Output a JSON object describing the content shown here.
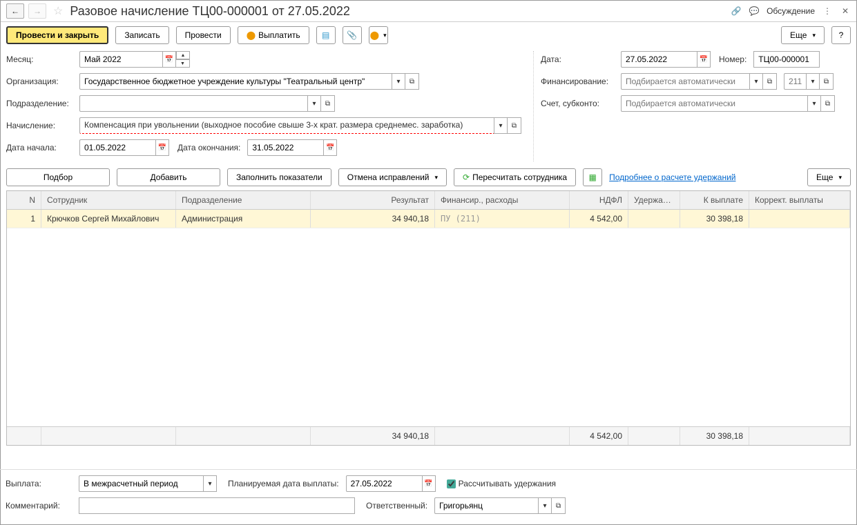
{
  "title": "Разовое начисление ТЦ00-000001 от 27.05.2022",
  "titlebar": {
    "discuss": "Обсуждение"
  },
  "toolbar": {
    "post_close": "Провести и закрыть",
    "save": "Записать",
    "post": "Провести",
    "pay": "Выплатить",
    "more": "Еще"
  },
  "form": {
    "month_lbl": "Месяц:",
    "month_val": "Май 2022",
    "org_lbl": "Организация:",
    "org_val": "Государственное бюджетное учреждение культуры \"Театральный центр\"",
    "dept_lbl": "Подразделение:",
    "dept_val": "",
    "accrual_lbl": "Начисление:",
    "accrual_val": "Компенсация при увольнении (выходное пособие свыше 3-х крат. размера среднемес. заработка)",
    "date_start_lbl": "Дата начала:",
    "date_start_val": "01.05.2022",
    "date_end_lbl": "Дата окончания:",
    "date_end_val": "31.05.2022",
    "date_lbl": "Дата:",
    "date_val": "27.05.2022",
    "number_lbl": "Номер:",
    "number_val": "ТЦ00-000001",
    "financing_lbl": "Финансирование:",
    "financing_ph": "Подбирается автоматически",
    "code_ph": "211",
    "account_lbl": "Счет, субконто:",
    "account_ph": "Подбирается автоматически"
  },
  "actions": {
    "pick": "Подбор",
    "add": "Добавить",
    "fill": "Заполнить показатели",
    "cancel_fix": "Отмена исправлений",
    "recalc": "Пересчитать сотрудника",
    "details": "Подробнее о расчете удержаний",
    "more": "Еще"
  },
  "table": {
    "headers": {
      "n": "N",
      "employee": "Сотрудник",
      "department": "Подразделение",
      "result": "Результат",
      "financing": "Финансир., расходы",
      "tax": "НДФЛ",
      "holdings": "Удержания",
      "payout": "К выплате",
      "correction": "Коррект. выплаты"
    },
    "rows": [
      {
        "n": "1",
        "employee": "Крючков Сергей Михайлович",
        "department": "Администрация",
        "result": "34 940,18",
        "financing": "ПУ (211)",
        "tax": "4 542,00",
        "holdings": "",
        "payout": "30 398,18",
        "correction": ""
      }
    ],
    "totals": {
      "result": "34 940,18",
      "tax": "4 542,00",
      "payout": "30 398,18"
    }
  },
  "footer": {
    "payment_lbl": "Выплата:",
    "payment_val": "В межрасчетный период",
    "plan_date_lbl": "Планируемая дата выплаты:",
    "plan_date_val": "27.05.2022",
    "calc_holdings": "Рассчитывать удержания",
    "comment_lbl": "Комментарий:",
    "comment_val": "",
    "responsible_lbl": "Ответственный:",
    "responsible_val": "Григорьянц"
  }
}
